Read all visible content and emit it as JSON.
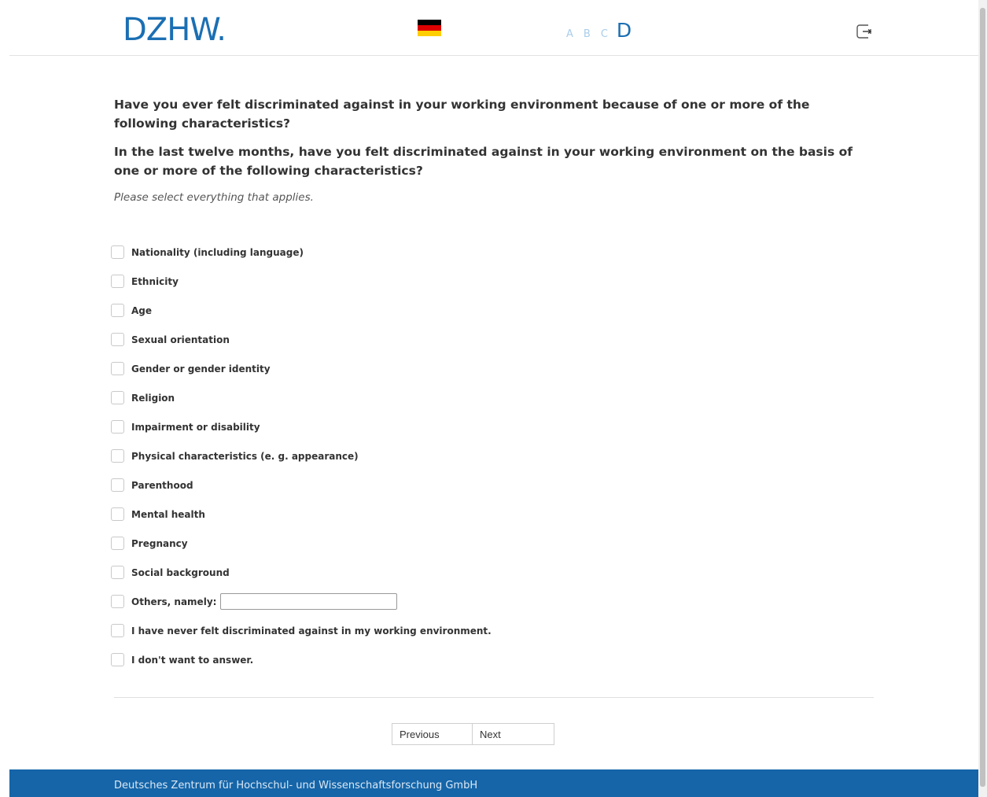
{
  "header": {
    "logo_text": "DZHW.",
    "language_flag": "german-flag-icon",
    "font_sizes": [
      "A",
      "B",
      "C",
      "D"
    ],
    "logout_icon": "logout-icon"
  },
  "question": {
    "title_1": "Have you ever felt discriminated against in your working environment because of one or more of the following characteristics?",
    "title_2": "In the last twelve months, have you felt discriminated against in your working environment on the basis of one or more of the following characteristics?",
    "instruction": "Please select everything that applies."
  },
  "options": [
    "Nationality (including language)",
    "Ethnicity",
    "Age",
    "Sexual orientation",
    "Gender or gender identity",
    "Religion",
    "Impairment or disability",
    "Physical characteristics (e. g. appearance)",
    "Parenthood",
    "Mental health",
    "Pregnancy",
    "Social background",
    "Others, namely:",
    "I have never felt discriminated against in my working environment.",
    "I don't want to answer."
  ],
  "other_input": {
    "value": "",
    "placeholder": ""
  },
  "navigation": {
    "previous_label": "Previous",
    "next_label": "Next"
  },
  "footer": {
    "text": "Deutsches Zentrum für Hochschul- und Wissenschaftsforschung GmbH"
  },
  "colors": {
    "brand_blue": "#1b6fb3",
    "footer_blue": "#1565a8",
    "font_size_inactive": "#a9cdea"
  }
}
